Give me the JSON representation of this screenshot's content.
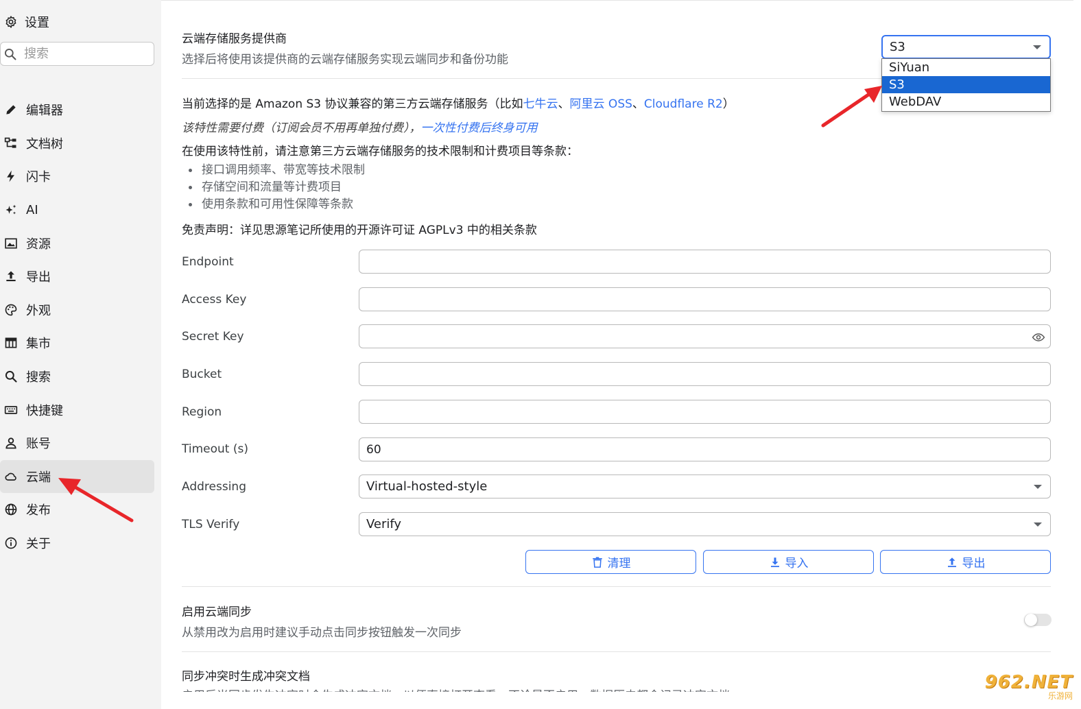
{
  "sidebar": {
    "title": "设置",
    "search_placeholder": "搜索",
    "items": [
      {
        "label": "编辑器",
        "icon": "pencil-icon"
      },
      {
        "label": "文档树",
        "icon": "tree-icon"
      },
      {
        "label": "闪卡",
        "icon": "lightning-icon"
      },
      {
        "label": "AI",
        "icon": "sparkle-icon"
      },
      {
        "label": "资源",
        "icon": "image-icon"
      },
      {
        "label": "导出",
        "icon": "upload-icon"
      },
      {
        "label": "外观",
        "icon": "palette-icon"
      },
      {
        "label": "集市",
        "icon": "store-icon"
      },
      {
        "label": "搜索",
        "icon": "search-icon"
      },
      {
        "label": "快捷键",
        "icon": "keyboard-icon"
      },
      {
        "label": "账号",
        "icon": "user-icon"
      },
      {
        "label": "云端",
        "icon": "cloud-icon",
        "active": true
      },
      {
        "label": "发布",
        "icon": "globe-icon"
      },
      {
        "label": "关于",
        "icon": "info-icon"
      }
    ]
  },
  "provider": {
    "title": "云端存储服务提供商",
    "desc": "选择后将使用该提供商的云端存储服务实现云端同步和备份功能",
    "selected": "S3",
    "options": [
      "SiYuan",
      "S3",
      "WebDAV"
    ]
  },
  "info": {
    "line1_prefix": "当前选择的是 Amazon S3 协议兼容的第三方云端存储服务（比如",
    "link1": "七牛云",
    "sep1": "、",
    "link2": "阿里云 OSS",
    "sep2": "、",
    "link3": "Cloudflare R2",
    "line1_suffix": "）",
    "paid_text": "该特性需要付费（订阅会员不用再单独付费），",
    "paid_link": "一次性付费后终身可用",
    "notice": "在使用该特性前，请注意第三方云端存储服务的技术限制和计费项目等条款：",
    "bullets": [
      "接口调用频率、带宽等技术限制",
      "存储空间和流量等计费项目",
      "使用条款和可用性保障等条款"
    ],
    "disclaimer": "免责声明：详见思源笔记所使用的开源许可证 AGPLv3 中的相关条款"
  },
  "fields": {
    "endpoint_label": "Endpoint",
    "endpoint_value": "",
    "access_key_label": "Access Key",
    "access_key_value": "",
    "secret_key_label": "Secret Key",
    "secret_key_value": "",
    "bucket_label": "Bucket",
    "bucket_value": "",
    "region_label": "Region",
    "region_value": "",
    "timeout_label": "Timeout (s)",
    "timeout_value": "60",
    "addressing_label": "Addressing",
    "addressing_value": "Virtual-hosted-style",
    "tls_label": "TLS Verify",
    "tls_value": "Verify"
  },
  "buttons": {
    "clear": "清理",
    "import": "导入",
    "export": "导出"
  },
  "sync": {
    "title": "启用云端同步",
    "desc": "从禁用改为启用时建议手动点击同步按钮触发一次同步",
    "enabled": false
  },
  "conflict": {
    "title": "同步冲突时生成冲突文档",
    "desc": "启用后当同步发生冲突时会生成冲突文档，以便直接打开查看。不论是否启用，数据历史都会记录冲突文档"
  },
  "watermark": {
    "main": "962.NET",
    "sub": "乐游网"
  },
  "colors": {
    "accent": "#3573f0",
    "selected_option": "#1967d2",
    "arrow": "#e8262a",
    "sidebar_bg": "#f3f3f3"
  }
}
